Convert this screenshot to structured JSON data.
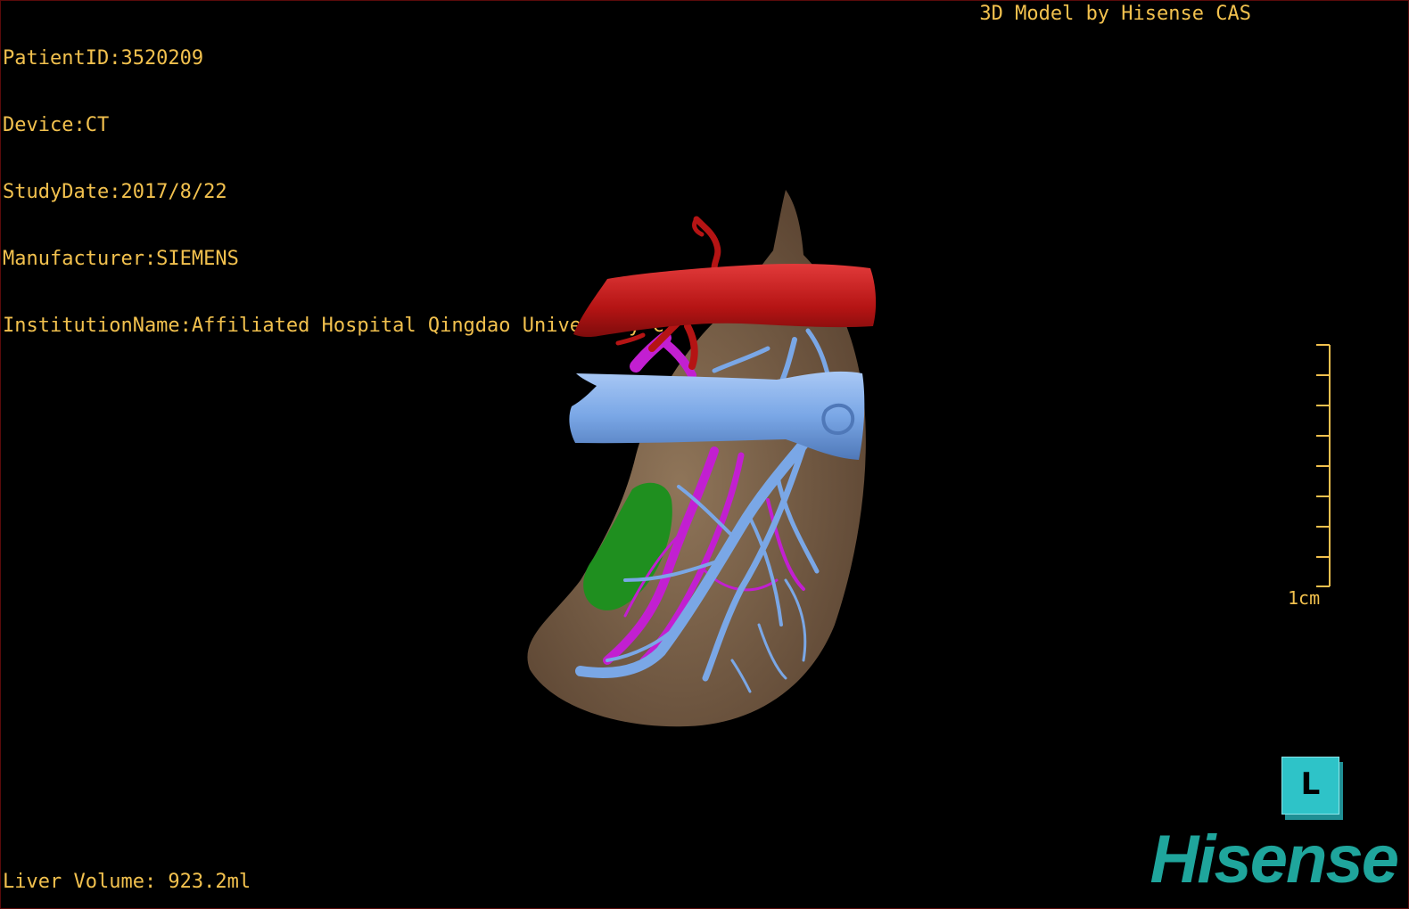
{
  "patient_info": {
    "patient_id": "PatientID:3520209",
    "device": "Device:CT",
    "study_date": "StudyDate:2017/8/22",
    "manufacturer": "Manufacturer:SIEMENS",
    "institution": "InstitutionName:Affiliated Hospital Qingdao University-C"
  },
  "caption": "3D Model by Hisense CAS",
  "liver_volume": "Liver Volume: 923.2ml",
  "scale_bar": {
    "label": "1cm"
  },
  "orientation_cube": {
    "face_label": "L"
  },
  "logo": "Hisense",
  "colors": {
    "text": "#f2c14e",
    "liver": "#7a6149",
    "artery": "#c11717",
    "portal_vein": "#7aa7e6",
    "hepatic_vein": "#c21fd1",
    "lesion": "#1f8f1f",
    "logo": "#1fa59c"
  },
  "structures": [
    "liver",
    "hepatic-vein",
    "portal-vein",
    "artery",
    "lesion"
  ]
}
